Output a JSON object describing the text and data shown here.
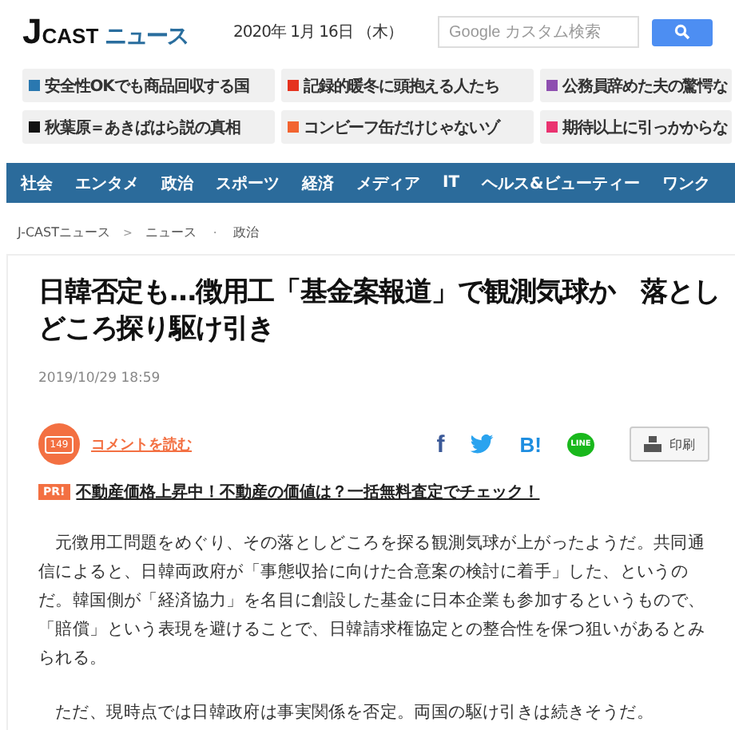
{
  "logo": {
    "mark": "J",
    "name": "CAST",
    "sub": "ニュース"
  },
  "date": "2020年 1月 16日 （木）",
  "search": {
    "placeholder": "Google カスタム検索"
  },
  "trending": [
    {
      "text": "安全性OKでも商品回収する国",
      "color": "#2a78b0"
    },
    {
      "text": "記録的暖冬に頭抱える人たち",
      "color": "#e5321e"
    },
    {
      "text": "公務員辞めた夫の驚愕な",
      "color": "#8e4fb0"
    },
    {
      "text": "秋葉原＝あきばはら説の真相",
      "color": "#111111"
    },
    {
      "text": "コンビーフ缶だけじゃないゾ",
      "color": "#f26430"
    },
    {
      "text": "期待以上に引っかからな",
      "color": "#ea3370"
    }
  ],
  "nav": [
    "社会",
    "エンタメ",
    "政治",
    "スポーツ",
    "経済",
    "メディア",
    "IT",
    "ヘルス&ビューティー",
    "ワンク"
  ],
  "breadcrumb": [
    {
      "text": "J-CASTニュース",
      "kind": "link"
    },
    {
      "text": ">",
      "kind": "sep"
    },
    {
      "text": "ニュース",
      "kind": "link"
    },
    {
      "text": "・",
      "kind": "sep"
    },
    {
      "text": "政治",
      "kind": "link"
    }
  ],
  "article": {
    "title": "日韓否定も…徴用工「基金案報道」で観測気球か　落としどころ探り駆け引き",
    "datetime": "2019/10/29 18:59",
    "comments": {
      "count": "149",
      "label": "コメントを読む"
    },
    "share": [
      {
        "kind": "facebook",
        "text": "f"
      },
      {
        "kind": "twitter"
      },
      {
        "kind": "hatena",
        "text": "B!"
      },
      {
        "kind": "line",
        "text": "LINE"
      }
    ],
    "print": "印刷",
    "pr": {
      "badge": "PR!",
      "text": "不動産価格上昇中！不動産の価値は？一括無料査定でチェック！"
    },
    "paragraphs": [
      "元徴用工問題をめぐり、その落としどころを探る観測気球が上がったようだ。共同通信によると、日韓両政府が「事態収拾に向けた合意案の検討に着手」した、というのだ。韓国側が「経済協力」を名目に創設した基金に日本企業も参加するというもので、「賠償」という表現を避けることで、日韓請求権協定との整合性を保つ狙いがあるとみられる。",
      "ただ、現時点では日韓政府は事実関係を否定。両国の駆け引きは続きそうだ。"
    ]
  }
}
